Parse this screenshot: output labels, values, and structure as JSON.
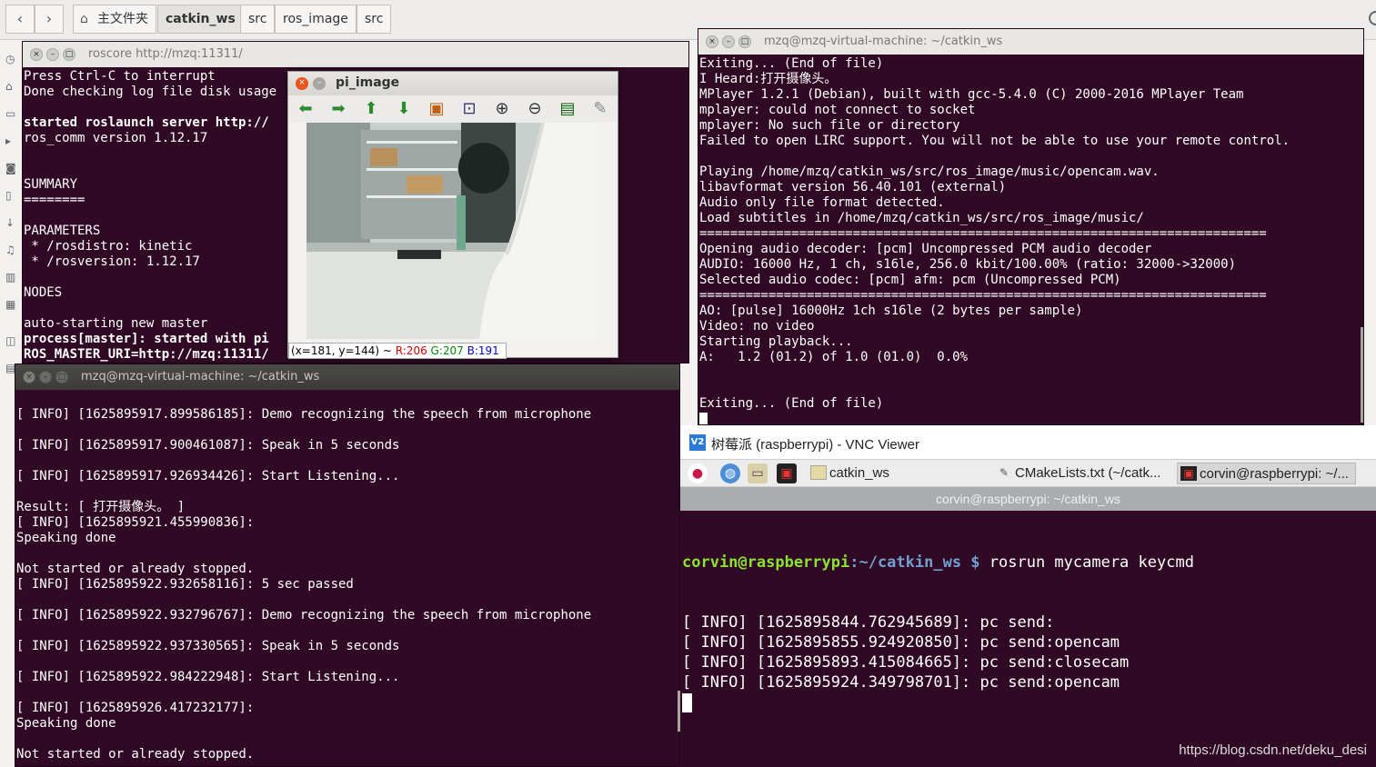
{
  "topbar": {
    "back": "‹",
    "forward": "›",
    "crumbs": [
      "主文件夹",
      "catkin_ws",
      "src",
      "ros_image",
      "src"
    ]
  },
  "roscore": {
    "title": "roscore http://mzq:11311/",
    "lines": [
      {
        "t": "Press Ctrl-C to interrupt",
        "b": false
      },
      {
        "t": "Done checking log file disk usage",
        "b": false
      },
      {
        "t": "",
        "b": false
      },
      {
        "t": "started roslaunch server http://",
        "b": true
      },
      {
        "t": "ros_comm version 1.12.17",
        "b": false
      },
      {
        "t": "",
        "b": false
      },
      {
        "t": "",
        "b": false
      },
      {
        "t": "SUMMARY",
        "b": false
      },
      {
        "t": "========",
        "b": false
      },
      {
        "t": "",
        "b": false
      },
      {
        "t": "PARAMETERS",
        "b": false
      },
      {
        "t": " * /rosdistro: kinetic",
        "b": false
      },
      {
        "t": " * /rosversion: 1.12.17",
        "b": false
      },
      {
        "t": "",
        "b": false
      },
      {
        "t": "NODES",
        "b": false
      },
      {
        "t": "",
        "b": false
      },
      {
        "t": "auto-starting new master",
        "b": false
      },
      {
        "t": "process[master]: started with pi",
        "b": true
      },
      {
        "t": "ROS_MASTER_URI=http://mzq:11311/",
        "b": true
      }
    ]
  },
  "mplayer": {
    "title": "mzq@mzq-virtual-machine: ~/catkin_ws",
    "lines": [
      "Exiting... (End of file)",
      "I Heard:打开摄像头。",
      "MPlayer 1.2.1 (Debian), built with gcc-5.4.0 (C) 2000-2016 MPlayer Team",
      "mplayer: could not connect to socket",
      "mplayer: No such file or directory",
      "Failed to open LIRC support. You will not be able to use your remote control.",
      "",
      "Playing /home/mzq/catkin_ws/src/ros_image/music/opencam.wav.",
      "libavformat version 56.40.101 (external)",
      "Audio only file format detected.",
      "Load subtitles in /home/mzq/catkin_ws/src/ros_image/music/",
      "==========================================================================",
      "Opening audio decoder: [pcm] Uncompressed PCM audio decoder",
      "AUDIO: 16000 Hz, 1 ch, s16le, 256.0 kbit/100.00% (ratio: 32000->32000)",
      "Selected audio codec: [pcm] afm: pcm (Uncompressed PCM)",
      "==========================================================================",
      "AO: [pulse] 16000Hz 1ch s16le (2 bytes per sample)",
      "Video: no video",
      "Starting playback...",
      "A:   1.2 (01.2) of 1.0 (01.0)  0.0%",
      "",
      "",
      "Exiting... (End of file)"
    ]
  },
  "speech": {
    "title": "mzq@mzq-virtual-machine: ~/catkin_ws",
    "lines": [
      "",
      "[ INFO] [1625895917.899586185]: Demo recognizing the speech from microphone",
      "",
      "[ INFO] [1625895917.900461087]: Speak in 5 seconds",
      "",
      "[ INFO] [1625895917.926934426]: Start Listening...",
      "",
      "Result: [ 打开摄像头。 ]",
      "[ INFO] [1625895921.455990836]:",
      "Speaking done",
      "",
      "Not started or already stopped.",
      "[ INFO] [1625895922.932658116]: 5 sec passed",
      "",
      "[ INFO] [1625895922.932796767]: Demo recognizing the speech from microphone",
      "",
      "[ INFO] [1625895922.937330565]: Speak in 5 seconds",
      "",
      "[ INFO] [1625895922.984222948]: Start Listening...",
      "",
      "[ INFO] [1625895926.417232177]:",
      "Speaking done",
      "",
      "Not started or already stopped."
    ]
  },
  "pi_image": {
    "title": "pi_image",
    "status_prefix": "(x=181, y=144) ~ ",
    "r": "R:206",
    "g": "G:207",
    "b": "B:191",
    "colors": {
      "r": "#d40000",
      "g": "#008a00",
      "b": "#0000d4"
    }
  },
  "vnc": {
    "logo": "V2",
    "title": "树莓派 (raspberrypi) - VNC Viewer",
    "taskbar": {
      "folder": "catkin_ws",
      "editor": "CMakeLists.txt (~/catk...",
      "terminal": "corvin@raspberrypi: ~/..."
    },
    "subtitle": "corvin@raspberrypi: ~/catkin_ws",
    "prompt_user": "corvin@raspberrypi",
    "prompt_path": ":~/catkin_ws $",
    "command": " rosrun mycamera keycmd",
    "lines": [
      "[ INFO] [1625895844.762945689]: pc send:",
      "[ INFO] [1625895855.924920850]: pc send:opencam",
      "[ INFO] [1625895893.415084665]: pc send:closecam",
      "[ INFO] [1625895924.349798701]: pc send:opencam"
    ]
  },
  "watermark": "https://blog.csdn.net/deku_desi"
}
